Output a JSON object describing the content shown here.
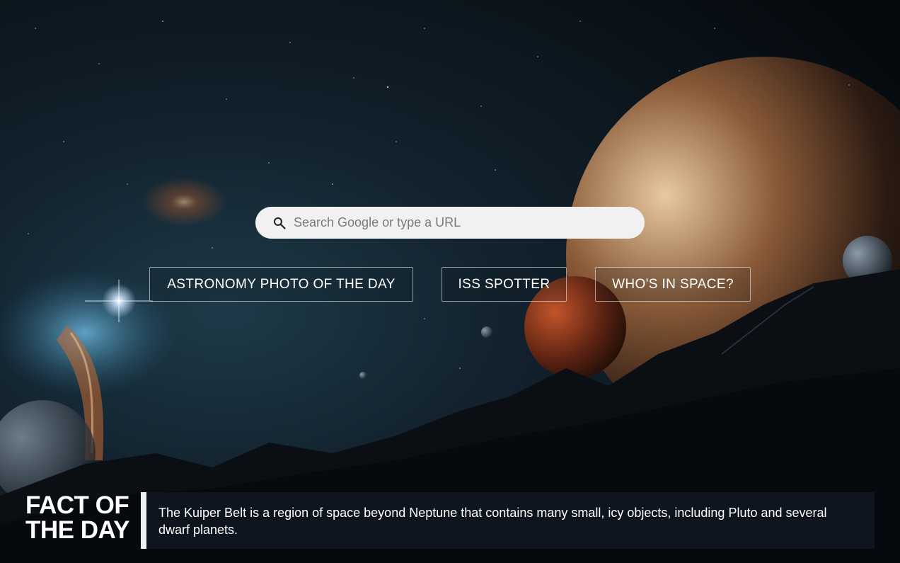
{
  "search": {
    "placeholder": "Search Google or type a URL",
    "icon": "search-icon"
  },
  "buttons": {
    "apod": "ASTRONOMY PHOTO OF THE DAY",
    "iss": "ISS SPOTTER",
    "who": "WHO'S IN SPACE?"
  },
  "fact": {
    "title_line1": "FACT OF",
    "title_line2": "THE DAY",
    "text": "The Kuiper Belt is a region of space beyond Neptune that contains many small, icy objects, including Pluto and several dwarf planets."
  },
  "colors": {
    "search_bg": "#f1f1f1",
    "fact_panel": "#111721",
    "fact_bar": "#f0f0f0"
  }
}
